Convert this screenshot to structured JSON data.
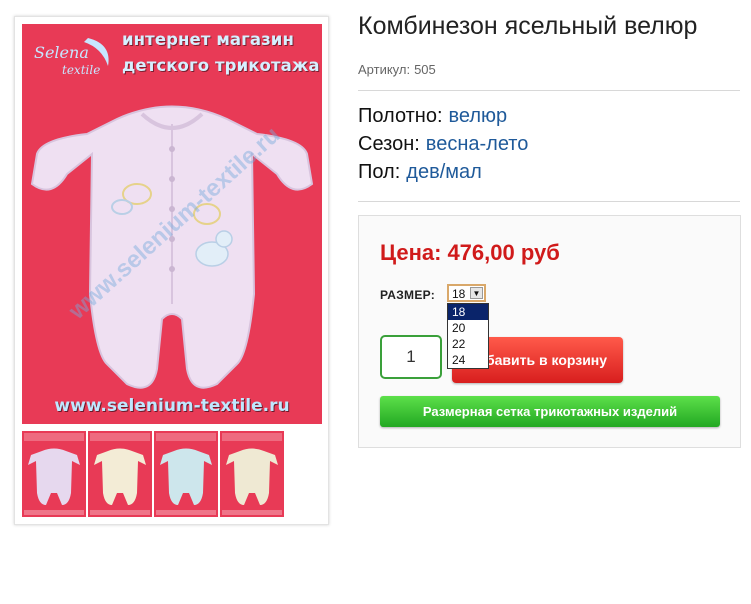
{
  "product": {
    "title": "Комбинезон ясельный велюр",
    "sku_label": "Артикул:",
    "sku_value": "505",
    "attributes": [
      {
        "label": "Полотно:",
        "value": "велюр"
      },
      {
        "label": "Сезон:",
        "value": "весна-лето"
      },
      {
        "label": "Пол:",
        "value": "дев/мал"
      }
    ]
  },
  "gallery": {
    "brand_logo_text": "Selena textile",
    "brand_line1": "интернет магазин",
    "brand_line2": "детского трикотажа",
    "watermark": "www.selenium-textile.ru",
    "site_url": "www.selenium-textile.ru",
    "thumbnails": [
      {
        "color": "#e6d8ee"
      },
      {
        "color": "#f3ecd6"
      },
      {
        "color": "#cde6ec"
      },
      {
        "color": "#efe9d3"
      }
    ],
    "background_color": "#e83a56"
  },
  "buy": {
    "price_label": "Цена:",
    "price_value": "476,00 руб",
    "size_label": "РАЗМЕР:",
    "size_selected": "18",
    "size_options": [
      "18",
      "20",
      "22",
      "24"
    ],
    "quantity": "1",
    "cart_button": "бавить в корзину",
    "size_chart_button": "Размерная сетка трикотажных изделий"
  },
  "colors": {
    "price": "#d01a1a",
    "attr_value": "#1f5a9a",
    "cart_button": "#e02424",
    "size_chart_button": "#32b82f"
  }
}
